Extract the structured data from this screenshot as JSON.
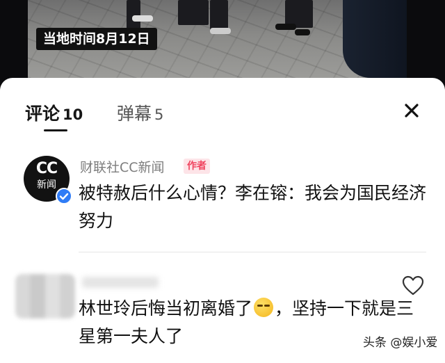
{
  "video": {
    "caption": "当地时间8月12日"
  },
  "tabs": [
    {
      "label": "评论",
      "count": "10"
    },
    {
      "label": "弹幕",
      "count": "5"
    }
  ],
  "comments": [
    {
      "avatar_text": "CC",
      "avatar_sub": "新闻",
      "author": "财联社CC新闻",
      "badge": "作者",
      "text": "被特赦后什么心情？李在镕：我会为国民经济努力"
    },
    {
      "text_part1": "林世玲后悔当初离婚了",
      "text_part2": "，坚持一下就是三星第一夫人了"
    }
  ],
  "watermark": "头条 @娱小爱",
  "icons": {
    "close": "close-icon",
    "like": "heart-outline-icon",
    "verified": "verified-check-icon",
    "emoji": "sly-smile-emoji-icon"
  },
  "colors": {
    "badge_bg": "#fde4e8",
    "badge_text": "#f0445f",
    "verified": "#2f7cf6"
  }
}
